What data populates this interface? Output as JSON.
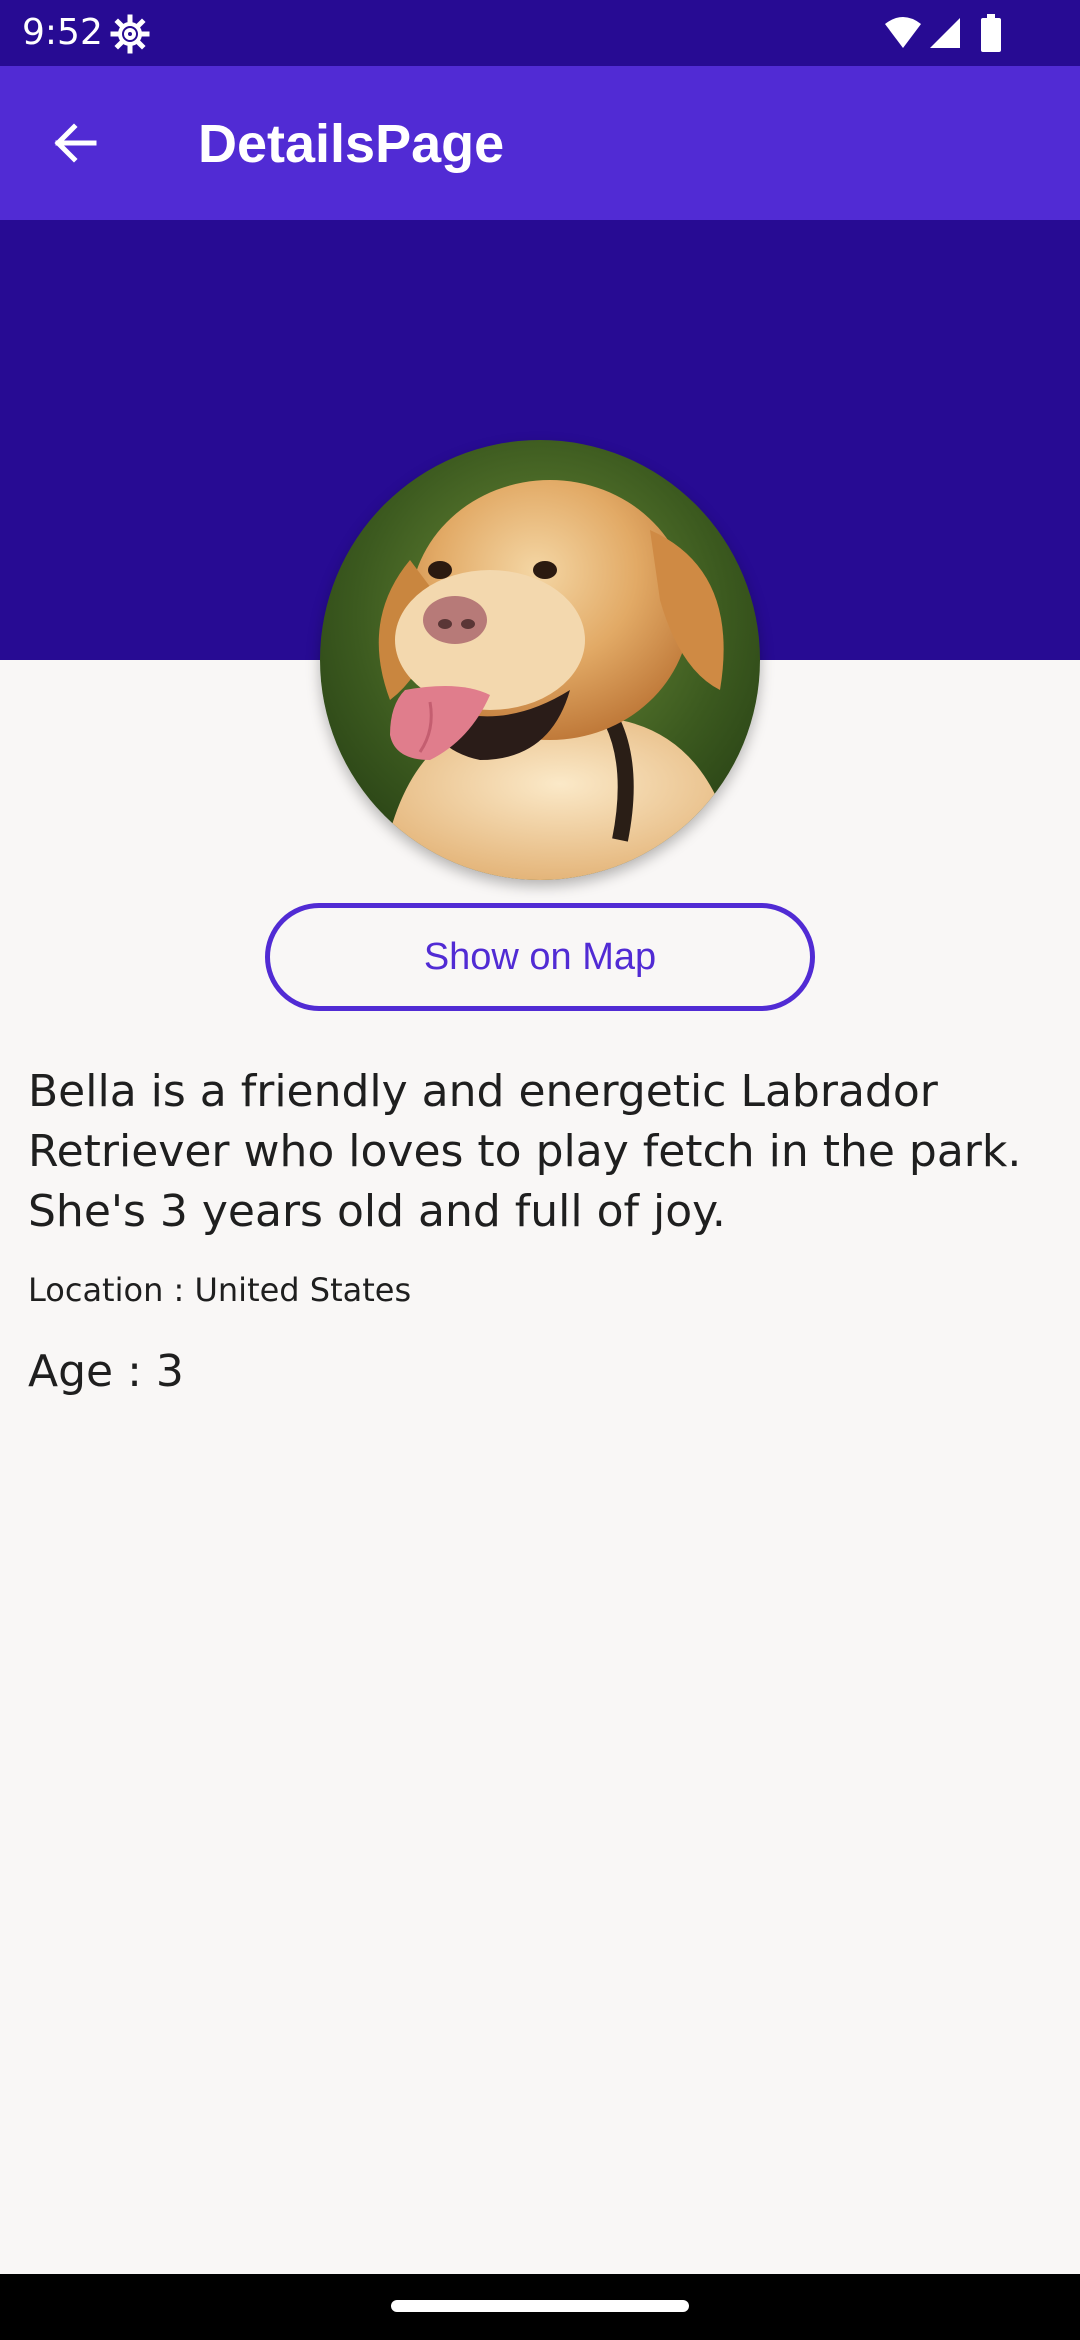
{
  "status_bar": {
    "time": "9:52",
    "icons": [
      "settings-icon",
      "wifi-icon",
      "cellular-signal-icon",
      "battery-icon"
    ]
  },
  "app_bar": {
    "back_icon": "arrow-back-icon",
    "title": "DetailsPage"
  },
  "theme": {
    "primary": "#512bd4",
    "primary_dark": "#270b93",
    "background": "#f9f7f6"
  },
  "pet": {
    "photo": "golden-labrador-photo",
    "map_button_label": "Show on Map",
    "description": "Bella is a friendly and energetic Labrador Retriever who loves to play fetch in the park. She's 3 years old and full of joy.",
    "location_text": "Location : United States",
    "age_text": "Age : 3"
  }
}
